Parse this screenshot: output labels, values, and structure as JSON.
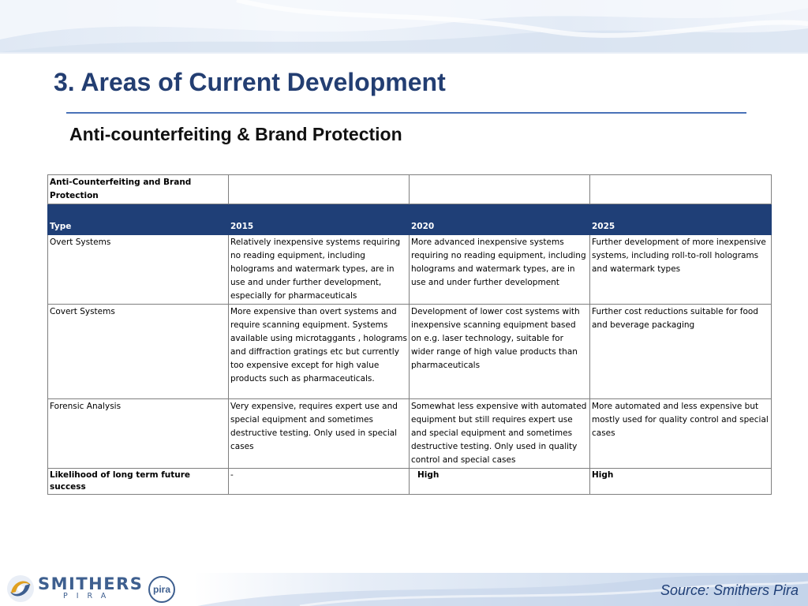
{
  "slide": {
    "title": "3. Areas of Current Development",
    "subtitle": "Anti-counterfeiting & Brand Protection",
    "source": "Source: Smithers Pira"
  },
  "logo": {
    "word": "SMITHERS",
    "sub": "PIRA",
    "badge": "pira"
  },
  "table": {
    "title": "Anti-Counterfeiting and Brand Protection",
    "headers": [
      "Type",
      "2015",
      "2020",
      "2025"
    ],
    "rows": [
      {
        "type": "Overt Systems",
        "y2015": "Relatively inexpensive systems requiring no reading equipment, including holograms  and watermark types, are in use and under further development, especially for pharmaceuticals",
        "y2020": "More advanced inexpensive systems requiring no reading equipment, including holograms  and watermark types, are in use and under further development",
        "y2025": "Further development of more inexpensive systems, including roll-to-roll holograms and watermark types"
      },
      {
        "type": "Covert Systems",
        "y2015": "More expensive than overt systems and require scanning equipment.  Systems available using microtaggants , holograms and diffraction gratings etc but currently too expensive except for high value products such as pharmaceuticals.",
        "y2020": "Development of lower cost systems with inexpensive scanning equipment based on e.g. laser technology, suitable for wider range of high value products than pharmaceuticals",
        "y2025": "Further cost reductions suitable for food and beverage packaging"
      },
      {
        "type": "Forensic Analysis",
        "y2015": "Very expensive, requires expert use and special equipment and  sometimes destructive testing.  Only used in special cases",
        "y2020": "Somewhat less expensive with automated equipment but still requires expert use and  special equipment and  sometimes destructive testing.  Only used in quality control and special cases",
        "y2025": "More  automated and less expensive but mostly used for quality control and special cases"
      }
    ],
    "likelihood": {
      "label": "Likelihood of long term future success",
      "y2015": "-",
      "y2020": "High",
      "y2025": "High"
    }
  },
  "colors": {
    "title": "#233e72",
    "header_fill": "#1f3f77",
    "rule": "#4a72b8",
    "source": "#1f3f77"
  }
}
